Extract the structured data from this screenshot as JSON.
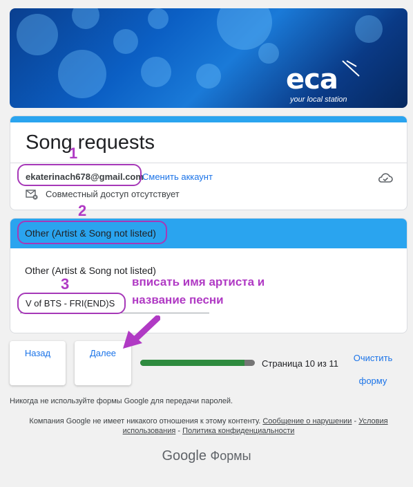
{
  "banner": {
    "logo_text": "eca",
    "tagline": "your local station"
  },
  "form": {
    "title": "Song requests",
    "account_email": "ekaterinach678@gmail.com",
    "switch_account": "Сменить аккаунт",
    "sharing_status": "Совместный доступ отсутствует"
  },
  "question": {
    "section_header": "Other (Artist & Song not listed)",
    "label": "Other (Artist & Song not listed)",
    "answer_value": "V of BTS - FRI(END)S"
  },
  "navigation": {
    "back_label": "Назад",
    "next_label": "Далее",
    "clear_label": "Очистить форму",
    "page_indicator": "Страница 10 из 11",
    "progress_fraction": 0.909
  },
  "footer": {
    "password_warning": "Никогда не используйте формы Google для передачи паролей.",
    "disclaimer": "Компания Google не имеет никакого отношения к этому контенту.",
    "report_link": "Сообщение о нарушении",
    "terms_link": "Условия использования",
    "privacy_link": "Политика конфиденциальности",
    "separator": " - ",
    "brand_google": "Google",
    "brand_forms": "Формы"
  },
  "annotations": {
    "num1": "1",
    "num2": "2",
    "num3": "3",
    "instruction_line1": "вписать имя артиста и",
    "instruction_line2": "название песни",
    "color": "#b03ac4"
  },
  "colors": {
    "accent_blue": "#2aa4ef",
    "link_blue": "#1a73e8",
    "progress_green": "#2e8b3f"
  }
}
